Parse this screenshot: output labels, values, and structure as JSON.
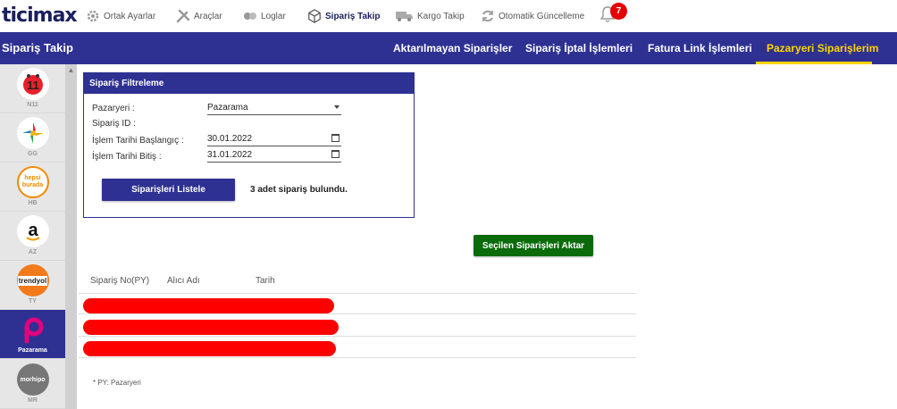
{
  "brand": {
    "logo_text": "ticimax"
  },
  "toolbar": {
    "items": [
      {
        "label": "Ortak Ayarlar",
        "icon": "gear-icon"
      },
      {
        "label": "Araçlar",
        "icon": "tools-icon"
      },
      {
        "label": "Loglar",
        "icon": "logs-icon"
      },
      {
        "label": "Sipariş Takip",
        "icon": "box-icon"
      },
      {
        "label": "Kargo Takip",
        "icon": "truck-icon"
      },
      {
        "label": "Otomatik Güncelleme",
        "icon": "refresh-icon"
      }
    ],
    "notification_count": "7"
  },
  "nav": {
    "title": "Sipariş Takip",
    "tabs": [
      {
        "label": "Aktarılmayan Siparişler"
      },
      {
        "label": "Sipariş İptal İşlemleri"
      },
      {
        "label": "Fatura Link İşlemleri"
      },
      {
        "label": "Pazaryeri Siparişlerim"
      }
    ]
  },
  "sidebar": {
    "marketplaces": [
      {
        "code": "N11",
        "logo_text": "11"
      },
      {
        "code": "GG",
        "logo_text": ""
      },
      {
        "code": "HB",
        "logo_text": "hepsi burada"
      },
      {
        "code": "AZ",
        "logo_text": "a"
      },
      {
        "code": "TY",
        "logo_text": "trendyol"
      },
      {
        "code": "Pazarama",
        "logo_text": "p"
      },
      {
        "code": "MR",
        "logo_text": "morhipo"
      }
    ]
  },
  "filter": {
    "title": "Sipariş Filtreleme",
    "fields": {
      "marketplace_label": "Pazaryeri :",
      "marketplace_value": "Pazarama",
      "order_id_label": "Sipariş ID :",
      "start_label": "İşlem Tarihi Başlangıç :",
      "start_value": "30.01.2022",
      "end_label": "İşlem Tarihi Bitiş :",
      "end_value": "31.01.2022"
    },
    "list_button": "Siparişleri Listele",
    "result_text": "3 adet sipariş bulundu."
  },
  "actions": {
    "transfer_button": "Seçilen Siparişleri Aktar"
  },
  "table": {
    "headers": [
      "Sipariş No(PY)",
      "Alıcı Adı",
      "Tarih"
    ],
    "rows": 3
  },
  "footnote": "* PY: Pazaryeri",
  "colors": {
    "primary": "#2e3192",
    "accent": "#ffd400",
    "success": "#0b6b0b",
    "alert": "#e40000",
    "redaction": "#ff0000"
  }
}
